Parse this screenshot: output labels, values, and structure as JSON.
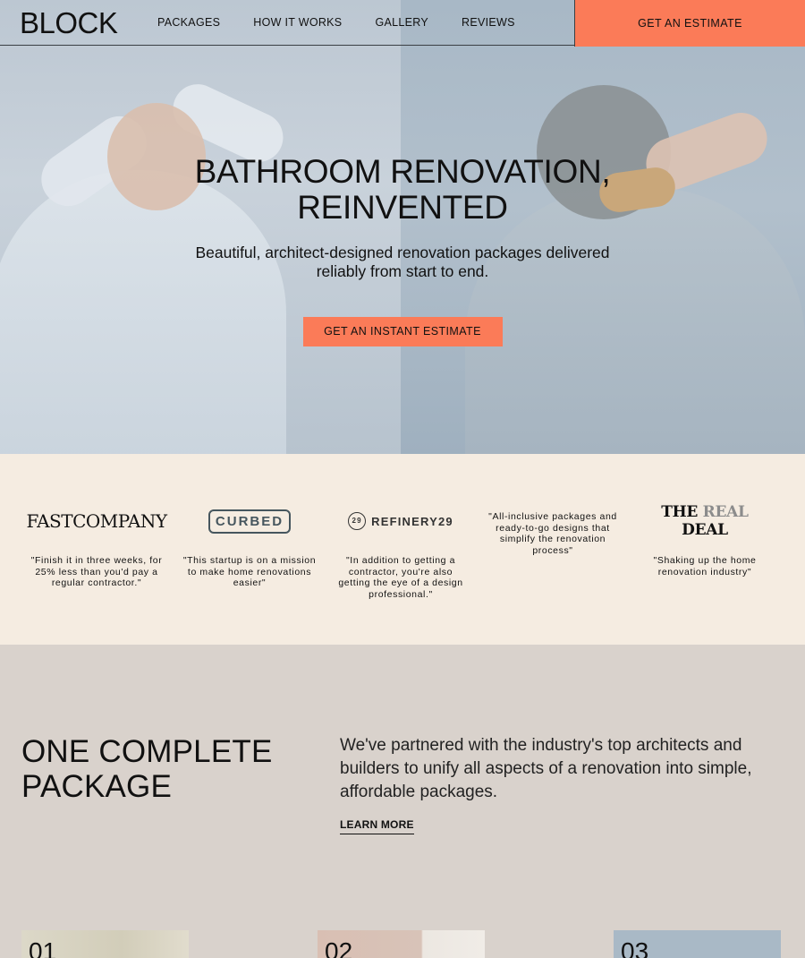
{
  "header": {
    "logo": "BLOCK",
    "nav": [
      "PACKAGES",
      "HOW IT WORKS",
      "GALLERY",
      "REVIEWS"
    ],
    "cta": "GET AN ESTIMATE"
  },
  "hero": {
    "title_line1": "BATHROOM RENOVATION,",
    "title_line2": "REINVENTED",
    "subtitle": "Beautiful, architect-designed renovation packages delivered reliably from start to end.",
    "cta": "GET AN INSTANT ESTIMATE"
  },
  "press": [
    {
      "logo": "FASTCOMPANY",
      "quote": "\"Finish it in three weeks, for 25% less than you'd pay a regular contractor.\""
    },
    {
      "logo": "CURBED",
      "quote": "\"This startup is on a mission to make home renovations easier\""
    },
    {
      "logo": "REFINERY29",
      "logo_badge": "29",
      "quote": "\"In addition to getting a contractor, you're also getting the eye of a design professional.\""
    },
    {
      "logo": "",
      "quote": "\"All-inclusive packages and ready-to-go designs that simplify the renovation process\""
    },
    {
      "logo_part1": "THE ",
      "logo_part2": "REAL ",
      "logo_part3": "DEAL",
      "quote": "\"Shaking up the home renovation industry\""
    }
  ],
  "package": {
    "title_line1": "ONE COMPLETE",
    "title_line2": "PACKAGE",
    "text": "We've partnered with the industry's top architects and builders to unify all aspects of a renovation into simple, affordable packages.",
    "learn_more": "LEARN MORE"
  },
  "cards": [
    "01",
    "02",
    "03"
  ],
  "colors": {
    "accent": "#fb7b58",
    "press_bg": "#f5ece1",
    "section_bg": "#d9d2cc"
  }
}
